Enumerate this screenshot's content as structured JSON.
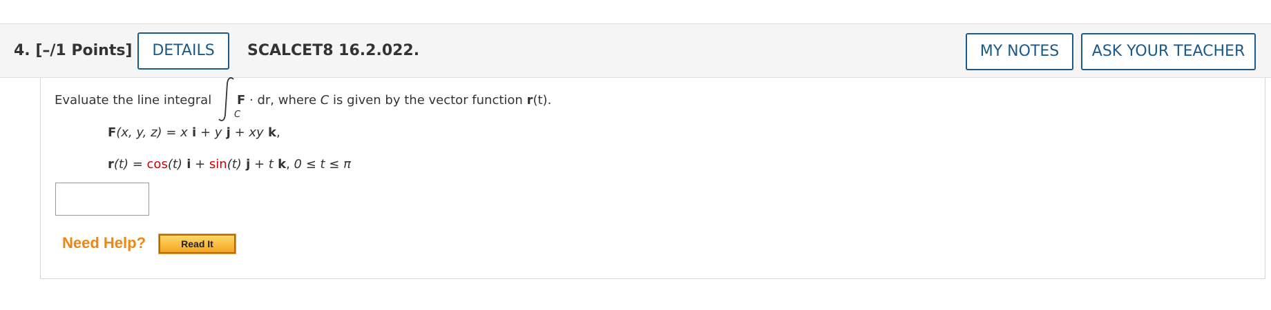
{
  "question": {
    "label": "4.  [–/1 Points]",
    "details_label": "DETAILS",
    "code": "SCALCET8 16.2.022.",
    "my_notes_label": "MY NOTES",
    "ask_teacher_label": "ASK YOUR TEACHER"
  },
  "prompt": {
    "intro": "Evaluate the line integral",
    "integral_subscript": "C",
    "integrand_F": "F",
    "integrand_rest": " · dr,  where ",
    "curve": "C",
    "after_curve": " is given by the vector function ",
    "r": "r",
    "r_arg": "(t)",
    "end": "."
  },
  "field": {
    "F_label": "F",
    "F_args": "(x, y, z)",
    "F_eq": " = ",
    "F_x": "x",
    "F_i": " i",
    "F_plus1": " + ",
    "F_y": "y",
    "F_j": " j",
    "F_plus2": " + ",
    "F_xy": "xy",
    "F_k": " k",
    "F_end": ","
  },
  "curve_fn": {
    "r_label": "r",
    "r_arg": "(t)",
    "eq": " = ",
    "cos": "cos",
    "cos_arg": "(t)",
    "i": " i",
    "plus1": " + ",
    "sin": "sin",
    "sin_arg": "(t)",
    "j": " j",
    "plus2": " + ",
    "t": "t",
    "k": " k",
    "comma": ",  ",
    "range": "0 ≤ t ≤ π"
  },
  "answer": {
    "value": ""
  },
  "help": {
    "need_help": "Need Help?",
    "read_it": "Read It"
  },
  "colors": {
    "button_border": "#1a5a8a",
    "function_red": "#cc0000",
    "need_help": "#f0850f",
    "read_it_bg": "#f6a623"
  }
}
